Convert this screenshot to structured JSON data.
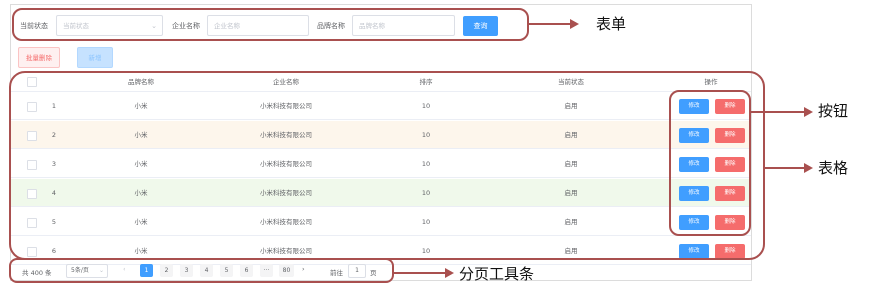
{
  "form": {
    "status_label": "当前状态",
    "status_placeholder": "当前状态",
    "company_label": "企业名称",
    "company_placeholder": "企业名称",
    "brand_label": "品牌名称",
    "brand_placeholder": "品牌名称",
    "query_label": "查询"
  },
  "actions": {
    "batch_delete_label": "批量删除",
    "add_label": "新增"
  },
  "table": {
    "columns": [
      "",
      "",
      "品牌名称",
      "企业名称",
      "排序",
      "当前状态",
      "操作"
    ],
    "edit_label": "修改",
    "delete_label": "删除",
    "rows": [
      {
        "index": "1",
        "brand": "小米",
        "company": "小米科技有限公司",
        "order": "10",
        "status": "启用"
      },
      {
        "index": "2",
        "brand": "小米",
        "company": "小米科技有限公司",
        "order": "10",
        "status": "启用"
      },
      {
        "index": "3",
        "brand": "小米",
        "company": "小米科技有限公司",
        "order": "10",
        "status": "启用"
      },
      {
        "index": "4",
        "brand": "小米",
        "company": "小米科技有限公司",
        "order": "10",
        "status": "启用"
      },
      {
        "index": "5",
        "brand": "小米",
        "company": "小米科技有限公司",
        "order": "10",
        "status": "启用"
      },
      {
        "index": "6",
        "brand": "小米",
        "company": "小米科技有限公司",
        "order": "10",
        "status": "启用"
      }
    ]
  },
  "pagination": {
    "total": "共 400 条",
    "page_size": "5条/页",
    "prev": "‹",
    "pages": [
      "1",
      "2",
      "3",
      "4",
      "5",
      "6",
      "···",
      "80"
    ],
    "current": "1",
    "next": "›",
    "goto_label": "前往",
    "goto_value": "1",
    "page_unit": "页"
  },
  "annotations": {
    "form": "表单",
    "buttons": "按钮",
    "table": "表格",
    "pagination": "分页工具条"
  },
  "colors": {
    "primary": "#409eff",
    "danger": "#f56c6c",
    "annotation": "#a9504f",
    "row_highlight_warm": "#fdf6ec",
    "row_highlight_green": "#f0f9eb"
  }
}
